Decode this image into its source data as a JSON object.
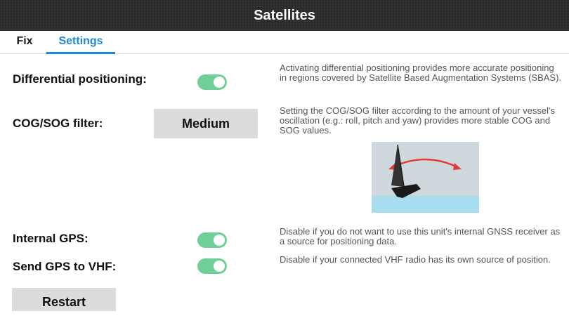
{
  "window": {
    "title": "Satellites"
  },
  "tabs": [
    {
      "label": "Fix",
      "active": false
    },
    {
      "label": "Settings",
      "active": true
    }
  ],
  "settings": {
    "differential": {
      "label": "Differential positioning:",
      "enabled": true,
      "description": "Activating differential positioning provides more accurate positioning in regions covered by Satellite Based Augmentation Systems (SBAS)."
    },
    "cog_sog": {
      "label": "COG/SOG filter:",
      "value": "Medium",
      "description": "Setting the COG/SOG filter according to the amount of your vessel's oscillation (e.g.: roll, pitch and yaw) provides more stable COG and SOG values."
    },
    "internal_gps": {
      "label": "Internal GPS:",
      "enabled": true,
      "description": "Disable if you do not want to use this unit's internal GNSS receiver as a source for positioning data."
    },
    "send_gps_vhf": {
      "label": "Send GPS to VHF:",
      "enabled": true,
      "description": "Disable if your connected VHF radio has its own source of position."
    }
  },
  "restart_label": "Restart",
  "colors": {
    "accent": "#1e88d6",
    "toggle_on": "#6fcf97",
    "button_bg": "#dcdcdc",
    "titlebar_bg": "#2b2b2b",
    "sky": "#cfd8dc",
    "water": "#a8dcef",
    "arrow": "#e53935"
  },
  "icons": {
    "boat": "sailboat-oscillation-illustration"
  }
}
